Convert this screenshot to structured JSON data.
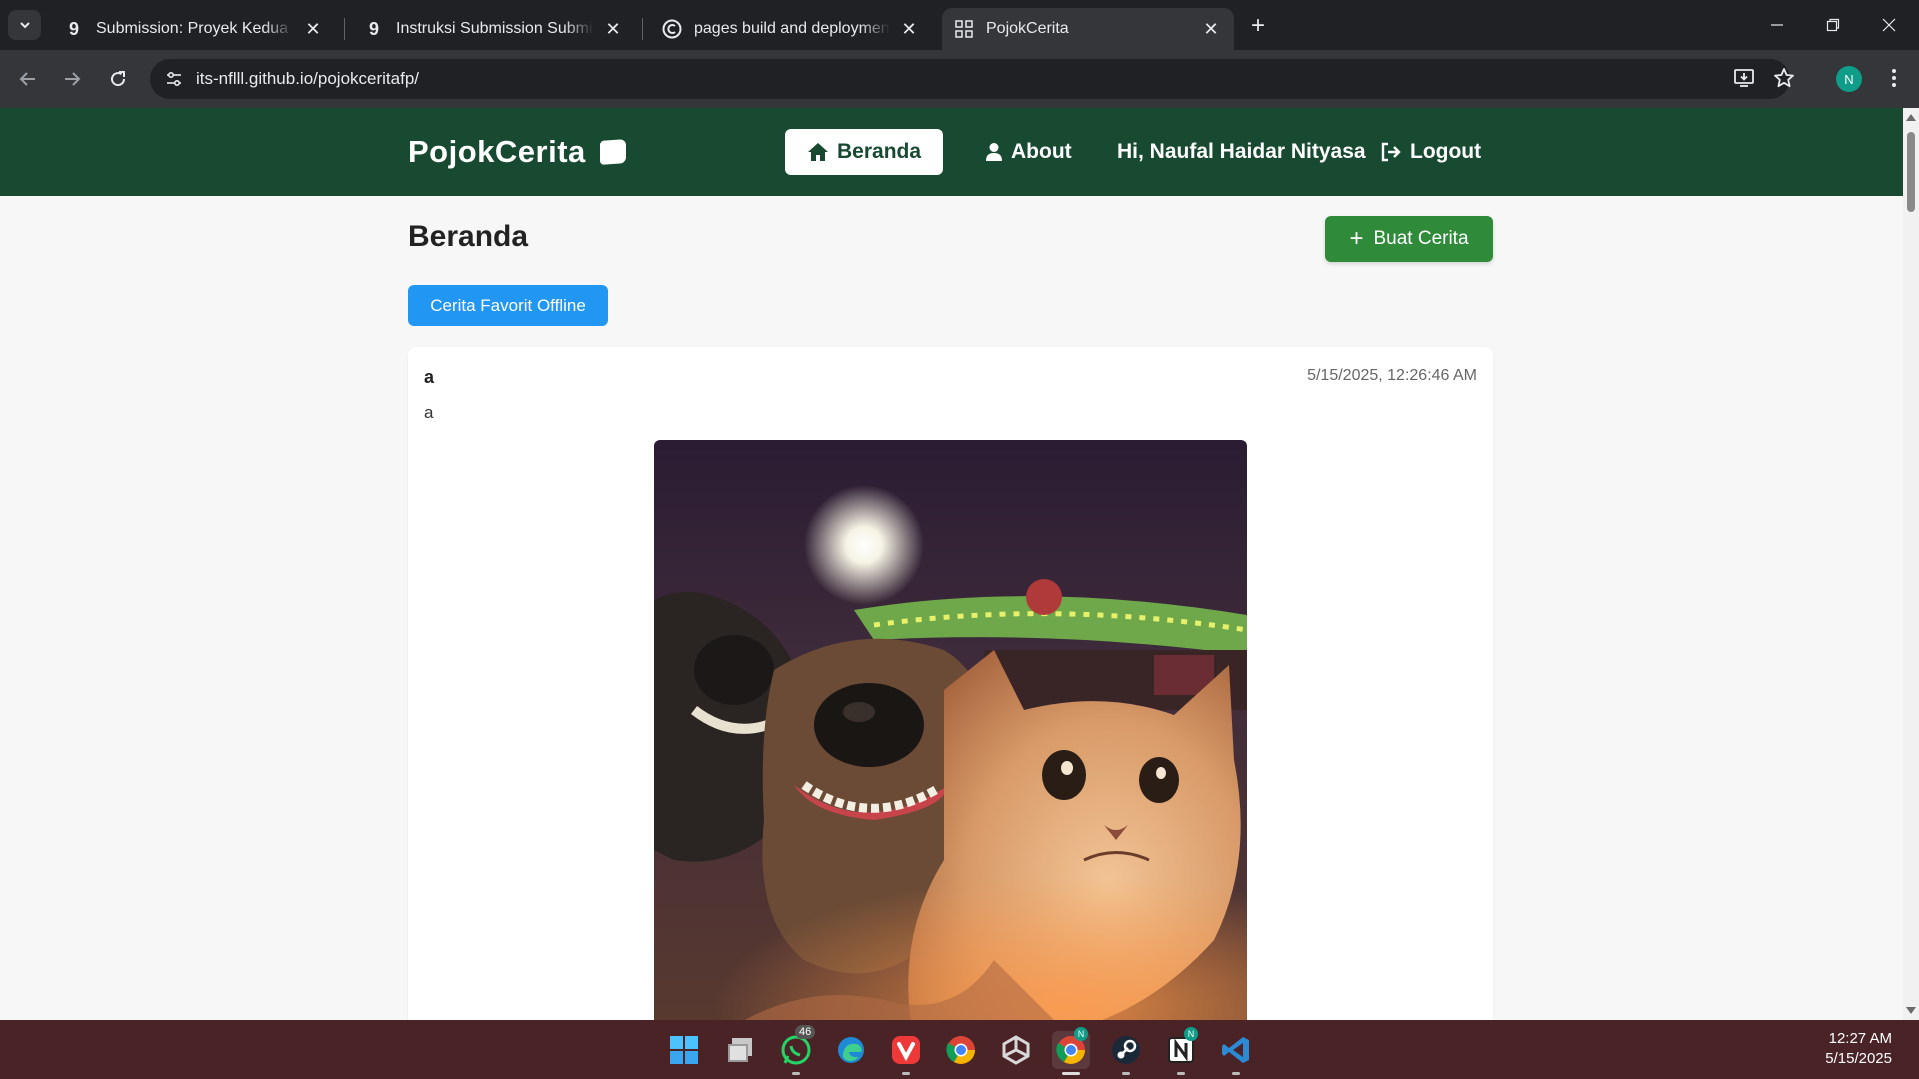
{
  "browser": {
    "tabs": [
      {
        "title": "Submission: Proyek Kedua | Bel",
        "favicon": "dicoding-icon"
      },
      {
        "title": "Instruksi Submission Submission",
        "favicon": "dicoding-icon"
      },
      {
        "title": "pages build and deployment · it",
        "favicon": "github-icon"
      },
      {
        "title": "PojokCerita",
        "favicon": "grid-icon",
        "active": true
      }
    ],
    "url": "its-nflll.github.io/pojokceritafp/",
    "profile_initial": "N"
  },
  "site": {
    "brand": "PojokCerita",
    "nav": {
      "home": "Beranda",
      "about": "About",
      "greeting": "Hi, Naufal Haidar Nityasa",
      "logout": "Logout"
    },
    "page_title": "Beranda",
    "create_button": "Buat Cerita",
    "favorites_button": "Cerita Favorit Offline",
    "colors": {
      "header": "#184a31",
      "create": "#2f8a3a",
      "favorites": "#2196f3"
    }
  },
  "stories": [
    {
      "name": "a",
      "date": "5/15/2025, 12:26:46 AM",
      "description": "a"
    }
  ],
  "taskbar": {
    "apps": [
      "windows-start-icon",
      "file-explorer-icon",
      "whatsapp-icon",
      "edge-icon",
      "vivaldi-icon",
      "chrome-icon",
      "unity-icon",
      "chrome-profile-icon",
      "steam-icon",
      "notion-icon",
      "vscode-icon"
    ],
    "whatsapp_badge": "46",
    "profile_badge": "N",
    "time": "12:27 AM",
    "date": "5/15/2025"
  }
}
